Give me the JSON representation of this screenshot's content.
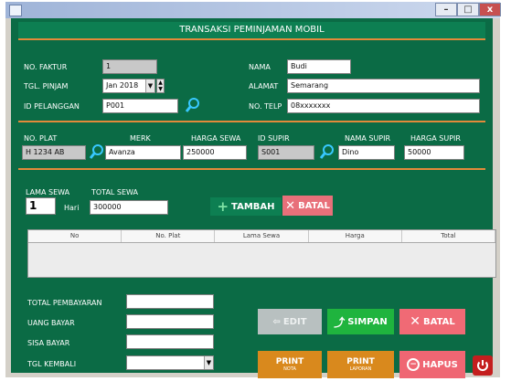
{
  "window": {
    "title": "",
    "minimize": "–",
    "maximize": "□",
    "close": "x"
  },
  "header": {
    "title": "TRANSAKSI PEMINJAMAN MOBIL"
  },
  "form": {
    "no_faktur_label": "NO. FAKTUR",
    "no_faktur": "1",
    "tgl_pinjam_label": "TGL. PINJAM",
    "tgl_pinjam": "Jan 2018",
    "id_pelanggan_label": "ID PELANGGAN",
    "id_pelanggan": "P001",
    "nama_label": "NAMA",
    "nama": "Budi",
    "alamat_label": "ALAMAT",
    "alamat": "Semarang",
    "no_telp_label": "NO. TELP",
    "no_telp": "08xxxxxxx"
  },
  "car": {
    "no_plat_label": "NO. PLAT",
    "no_plat": "H 1234 AB",
    "merk_label": "MERK",
    "merk": "Avanza",
    "harga_sewa_label": "HARGA SEWA",
    "harga_sewa": "250000",
    "id_supir_label": "ID SUPIR",
    "id_supir": "S001",
    "nama_supir_label": "NAMA SUPIR",
    "nama_supir": "Dino",
    "harga_supir_label": "HARGA SUPIR",
    "harga_supir": "50000"
  },
  "rental": {
    "lama_sewa_label": "LAMA SEWA",
    "lama_sewa": "1",
    "hari_label": "Hari",
    "total_sewa_label": "TOTAL SEWA",
    "total_sewa": "300000"
  },
  "buttons": {
    "tambah": "TAMBAH",
    "batal": "BATAL",
    "edit": "EDIT",
    "simpan": "SIMPAN",
    "batal2": "BATAL",
    "print1": "PRINT",
    "print1_sub": "NOTA",
    "print2": "PRINT",
    "print2_sub": "LAPORAN",
    "hapus": "HAPUS"
  },
  "table": {
    "columns": [
      "No",
      "No. Plat",
      "Lama Sewa",
      "Harga",
      "Total"
    ]
  },
  "summary": {
    "total_label": "TOTAL PEMBAYARAN",
    "bayar_label": "UANG BAYAR",
    "sisa_label": "SISA BAYAR",
    "tgl_kembali_label": "TGL KEMBALI"
  },
  "colors": {
    "bg": "#0b6b45",
    "accent": "#e28a3a",
    "simpan": "#1fb43e",
    "batal": "#f06a75",
    "print": "#d9891d"
  }
}
